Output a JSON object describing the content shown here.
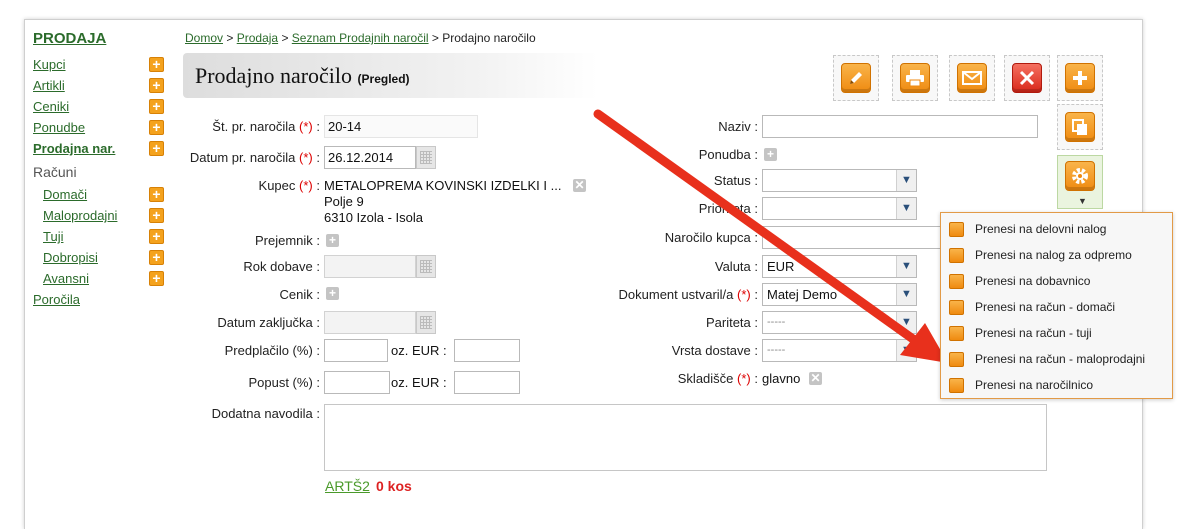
{
  "sidebar": {
    "title": "PRODAJA",
    "items_top": [
      {
        "label": "Kupci"
      },
      {
        "label": "Artikli"
      },
      {
        "label": "Ceniki"
      },
      {
        "label": "Ponudbe"
      },
      {
        "label": "Prodajna nar."
      }
    ],
    "section_label": "Računi",
    "items_sub": [
      {
        "label": "Domači"
      },
      {
        "label": "Maloprodajni"
      },
      {
        "label": "Tuji"
      },
      {
        "label": "Dobropisi"
      },
      {
        "label": "Avansni"
      }
    ],
    "reports": "Poročila",
    "plus": "+"
  },
  "breadcrumb": {
    "home": "Domov",
    "sep": ">",
    "sales": "Prodaja",
    "list": "Seznam Prodajnih naročil",
    "current": "Prodajno naročilo"
  },
  "header": {
    "title": "Prodajno naročilo",
    "mode": "(Pregled)"
  },
  "form": {
    "req_mark": "(*)",
    "order_no_label": "Št. pr. naročila",
    "order_no": "20-14",
    "order_date_label": "Datum pr. naročila",
    "order_date": "26.12.2014",
    "customer_label": "Kupec",
    "customer_name": "METALOPREMA KOVINSKI IZDELKI I ...",
    "customer_street": "Polje 9",
    "customer_city": "6310 Izola - Isola",
    "recipient_label": "Prejemnik :",
    "deadline_label": "Rok dobave :",
    "pricelist_label": "Cenik :",
    "close_date_label": "Datum zaključka :",
    "prepay_label": "Predplačilo (%) :",
    "discount_label": "Popust (%) :",
    "or_eur_label": "oz. EUR :",
    "notes_label": "Dodatna navodila :",
    "name_label": "Naziv :",
    "offer_label": "Ponudba :",
    "status_label": "Status :",
    "priority_label": "Prioriteta :",
    "cust_order_label": "Naročilo kupca :",
    "currency_label": "Valuta :",
    "currency": "EUR",
    "created_by_label": "Dokument ustvaril/a",
    "created_by": "Matej Demo",
    "parity_label": "Pariteta :",
    "parity": "-----",
    "delivery_label": "Vrsta dostave :",
    "delivery": "-----",
    "warehouse_label": "Skladišče",
    "warehouse": "glavno",
    "colon": ":"
  },
  "articles": {
    "link": "ARTŠ2",
    "count": "0 kos"
  },
  "menu": {
    "items": [
      {
        "label": "Prenesi na delovni nalog"
      },
      {
        "label": "Prenesi na nalog za odpremo"
      },
      {
        "label": "Prenesi na dobavnico"
      },
      {
        "label": "Prenesi na račun - domači"
      },
      {
        "label": "Prenesi na račun - tuji"
      },
      {
        "label": "Prenesi na račun - maloprodajni"
      },
      {
        "label": "Prenesi na naročilnico"
      }
    ]
  },
  "colors": {
    "link_green": "#2b6b2b",
    "accent_orange": "#f4a21d",
    "arrow_red": "#e8301c",
    "required_red": "#dd0000"
  }
}
